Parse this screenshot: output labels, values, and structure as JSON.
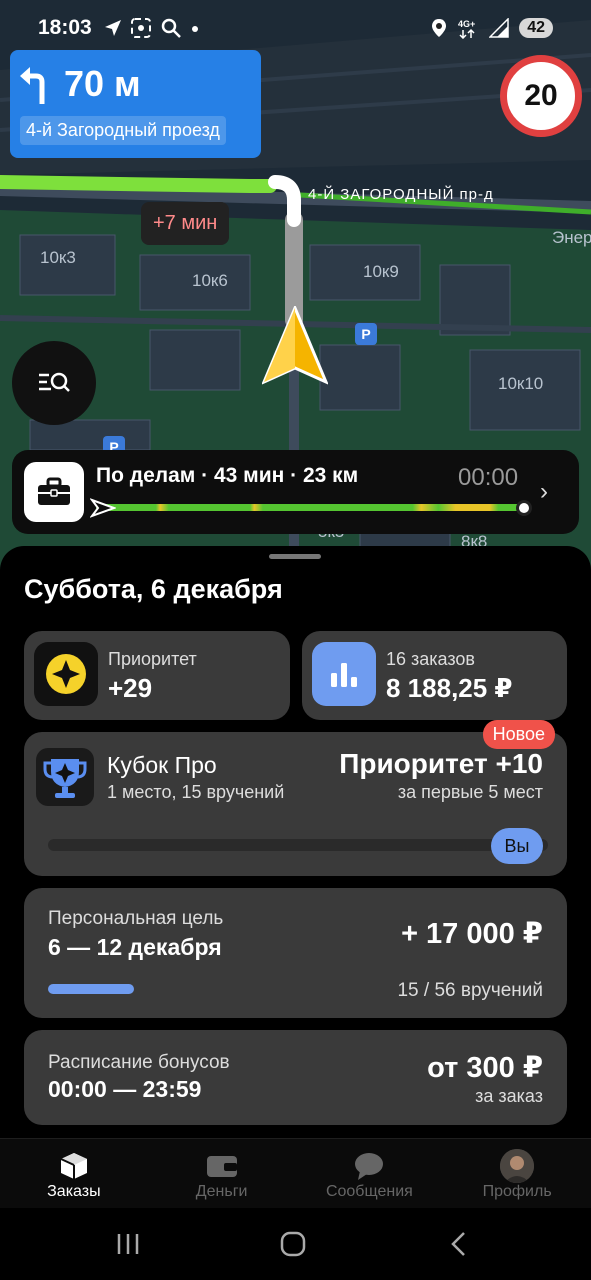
{
  "status_bar": {
    "time": "18:03",
    "left_icons": [
      "navigation-arrow-icon",
      "screenshot-icon",
      "search-icon",
      "dot-icon"
    ],
    "right_icons": [
      "location-pin-icon",
      "4g-icon",
      "signal-icon"
    ],
    "battery": "42"
  },
  "map": {
    "maneuver": {
      "turn": "left-turn-icon",
      "distance": "70 м",
      "street": "4-й Загородный проезд"
    },
    "speed_limit": "20",
    "delay": "+7 мин",
    "road_label": "4-Й ЗАГОРОДНЫЙ пр-д",
    "labels": [
      "10к3",
      "10к6",
      "10к9",
      "10к10",
      "Энер",
      "8к8",
      "5к5"
    ],
    "parking": "P"
  },
  "route": {
    "summary": "По делам · 43 мин · 23 км",
    "eta": "00:00"
  },
  "sheet": {
    "date": "Суббота, 6 декабря",
    "priority": {
      "label": "Приоритет",
      "value": "+29"
    },
    "orders": {
      "label": "16 заказов",
      "value": "8 188,25 ₽"
    },
    "cup": {
      "badge": "Новое",
      "title": "Кубок Про",
      "subtitle": "1 место, 15 вручений",
      "reward": "Приоритет +10",
      "reward_sub": "за первые 5 мест",
      "you": "Вы"
    },
    "goal": {
      "label": "Персональная цель",
      "dates": "6 — 12 декабря",
      "amount": "+ 17 000 ₽",
      "count": "15 / 56 вручений",
      "progress": 0.27
    },
    "bonus": {
      "label": "Расписание бонусов",
      "time": "00:00 — 23:59",
      "amount": "от 300 ₽",
      "per": "за заказ"
    }
  },
  "nav": {
    "items": [
      {
        "label": "Заказы",
        "icon": "orders-box-icon",
        "active": true
      },
      {
        "label": "Деньги",
        "icon": "wallet-icon",
        "active": false
      },
      {
        "label": "Сообщения",
        "icon": "chat-bubble-icon",
        "active": false
      },
      {
        "label": "Профиль",
        "icon": "avatar-icon",
        "active": false
      }
    ]
  },
  "colors": {
    "accent_blue": "#2680e6",
    "route_green": "#55c531",
    "badge_red": "#f0524a",
    "card_bg": "#3a3a3a"
  }
}
